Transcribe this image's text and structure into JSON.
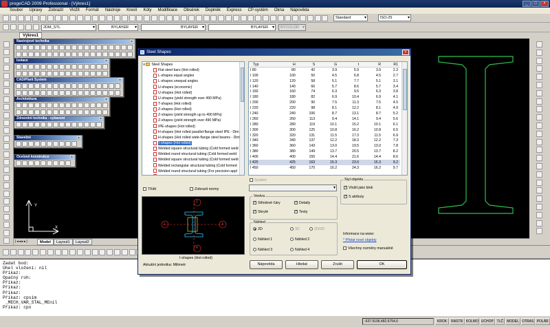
{
  "window": {
    "title": "progeCAD 2009 Professional - [Výkres1]"
  },
  "menu": [
    "Soubor",
    "Úpravy",
    "Zobrazit",
    "Vložit",
    "Formát",
    "Nástroje",
    "Kreslí",
    "Kóty",
    "Modifikace",
    "Obsérek",
    "Doplněk",
    "Express",
    "CP-systém",
    "Okna",
    "Nápověda"
  ],
  "toolbar": {
    "text_style": "Standard",
    "dim_style": "ISO-25",
    "layer": "2DM_STL",
    "color": "BYLAYER",
    "linetype": "BYLAYER",
    "lineweight": "BYLAYER",
    "plotstyle": "BYCOLOR"
  },
  "document_tab": "Výkres1",
  "palettes": [
    "Nastrojové technika",
    "Izolace",
    "CAD/Plant System",
    "Architektura",
    "Zdravotní technika - vybavení",
    "Stavební",
    "Ocelové konstrukce"
  ],
  "layout_tabs": [
    "Model",
    "Layout1",
    "Layout2"
  ],
  "dialog": {
    "title": "Steel Shapes",
    "tree_root": "Steel Shapes",
    "tree_items": [
      "Flat steel bars (Hot rolled)",
      "L-shapes equal angles",
      "L-shapes unequal angles",
      "U-shapes (economic)",
      "U-shapes (Hot rolled)",
      "U-shapes (yield strength over 490 MPa)",
      "T-shapes (Hot rolled)",
      "Z-shapes (Hot rolled)",
      "Z-shapes (yield strength up to 490 MPa)",
      "Z-shapes (yield strength over 490 MPa)",
      "IPE-shapes (Hot rolled)",
      "H-shapes (Hot rolled parallel-flange steel IPE - Dim",
      "H-shapes (Hot rolled wide-flange steel beams - Dim",
      "I-shapes (Hot rolled)",
      "Welded square structural tubing (Cold formed weld",
      "Welded round structural tubing (Cold formed weld",
      "Welded square structural tubing (Cold formed weld",
      "Welded rectangular structural tubing (Cold formed",
      "Welded round structural tubing (For precision appl",
      "Welded rectangular structural tubing (For precision",
      "Welded rectangular structural tubing (For precision"
    ],
    "selected_tree_index": 13,
    "tree_folders": [
      "Steel Bars",
      "Steel Rods"
    ],
    "table_headers": [
      "Typ",
      "H",
      "S",
      "G",
      "t",
      "R",
      "R1"
    ],
    "table_rows": [
      [
        "I 80",
        "80",
        "42",
        "3.9",
        "5.9",
        "3.9",
        "2.3"
      ],
      [
        "I 100",
        "100",
        "50",
        "4.5",
        "6.8",
        "4.5",
        "2.7"
      ],
      [
        "I 120",
        "120",
        "58",
        "5.1",
        "7.7",
        "5.1",
        "3.1"
      ],
      [
        "I 140",
        "140",
        "66",
        "5.7",
        "8.6",
        "5.7",
        "3.4"
      ],
      [
        "I 160",
        "160",
        "74",
        "6.3",
        "9.5",
        "6.3",
        "3.8"
      ],
      [
        "I 180",
        "180",
        "82",
        "6.9",
        "10.4",
        "6.9",
        "4.1"
      ],
      [
        "I 200",
        "200",
        "90",
        "7.5",
        "11.3",
        "7.5",
        "4.5"
      ],
      [
        "I 220",
        "220",
        "98",
        "8.1",
        "12.2",
        "8.1",
        "4.9"
      ],
      [
        "I 240",
        "240",
        "106",
        "8.7",
        "13.1",
        "8.7",
        "5.2"
      ],
      [
        "I 260",
        "260",
        "113",
        "9.4",
        "14.1",
        "9.4",
        "5.6"
      ],
      [
        "I 280",
        "280",
        "119",
        "10.1",
        "15.2",
        "10.1",
        "6.1"
      ],
      [
        "I 300",
        "300",
        "125",
        "10.8",
        "16.2",
        "10.8",
        "6.5"
      ],
      [
        "I 320",
        "320",
        "131",
        "11.5",
        "17.3",
        "11.5",
        "6.9"
      ],
      [
        "I 340",
        "340",
        "137",
        "12.2",
        "18.3",
        "12.2",
        "7.3"
      ],
      [
        "I 360",
        "360",
        "143",
        "13.0",
        "19.5",
        "13.0",
        "7.8"
      ],
      [
        "I 380",
        "380",
        "149",
        "13.7",
        "20.5",
        "13.7",
        "8.2"
      ],
      [
        "I 400",
        "400",
        "155",
        "14.4",
        "21.6",
        "14.4",
        "8.6"
      ],
      [
        "I 425",
        "425",
        "163",
        "15.3",
        "23.0",
        "15.3",
        "9.2"
      ],
      [
        "I 450",
        "450",
        "170",
        "16.2",
        "24.3",
        "16.2",
        "9.7"
      ]
    ],
    "selected_row_index": 17,
    "trim_label": "Třídit",
    "show_norms_label": "Zobrazit normy",
    "system_label": "Systém",
    "view_group": "Vestva",
    "view_checks": [
      {
        "label": "Středové čáry",
        "checked": true
      },
      {
        "label": "Detaily",
        "checked": true
      },
      {
        "label": "Skryté",
        "checked": true
      },
      {
        "label": "Texty",
        "checked": true
      }
    ],
    "preview_group": "Náhled",
    "preview_opts": [
      {
        "label": "2D",
        "on": true
      },
      {
        "label": "3D",
        "on": false
      },
      {
        "label": "2D/3D",
        "on": false
      },
      {
        "label": "Náhled 1",
        "on": false
      },
      {
        "label": "Náhled 2",
        "on": false
      },
      {
        "label": "Náhled 3",
        "on": false
      },
      {
        "label": "Náhled 4",
        "on": false
      }
    ],
    "object_group": "Styl objektu",
    "object_checks": [
      {
        "label": "Vložit jako blok",
        "checked": true
      },
      {
        "label": "S atributy",
        "checked": true
      }
    ],
    "info_label": "Informace na www:",
    "info_link": "* Přidat nové objekty",
    "all_dims_label": "Všechny rozměry manuálně",
    "preview_caption": "I-shapes (Hot rolled)",
    "units": "Aktuální jednotka: Milimetr",
    "preview_markers": [
      "1",
      "2",
      "3",
      "4"
    ],
    "buttons": {
      "help": "Nápověda",
      "search": "Hledat",
      "cancel": "Zrušit",
      "ok": "OK"
    }
  },
  "command_lines": [
    "Zadat bod:",
    "Úhel vložení: nil",
    "Příkaz:",
    "Opačný roh:",
    "Příkaz:",
    "Příkaz:",
    "Příkaz:",
    "Příkaz: cpsim",
    " _MECH_VAR_STAL_MEnil",
    "Příkaz: cpx"
  ],
  "status": {
    "coords": "-637.9196,482.6754,0",
    "buttons": [
      "KROK",
      "RASTR",
      "KOLMO",
      "UCHOP",
      "TLČ",
      "MODEL",
      "OTRAS",
      "POLÁR"
    ]
  },
  "colors": {
    "canvas": "#000000",
    "beam": "#2fbf4f",
    "title": "#0a246a"
  }
}
